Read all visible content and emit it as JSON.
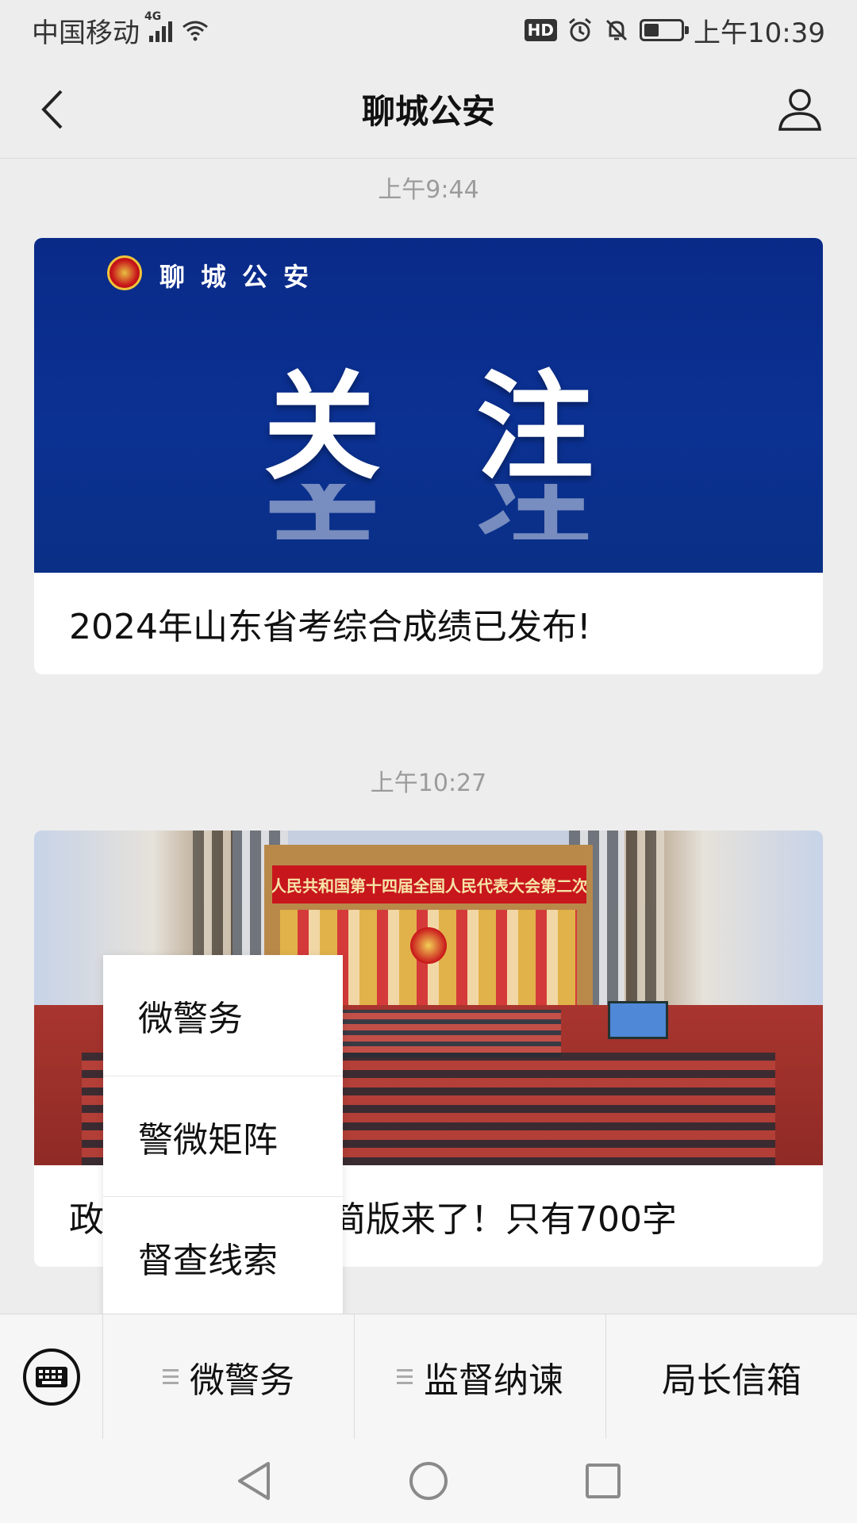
{
  "status_bar": {
    "carrier": "中国移动",
    "network_tag": "4G",
    "hd_label": "HD",
    "time": "上午10:39",
    "battery_level": 0.4
  },
  "nav": {
    "title": "聊城公安"
  },
  "messages": [
    {
      "time": "上午9:44",
      "image_brand": "聊城公安",
      "image_headline": "关注",
      "title": "2024年山东省考综合成绩已发布!"
    },
    {
      "time": "上午10:27",
      "image_banner": "中华人民共和国第十四届全国人民代表大会第二次会议",
      "title_prefix": "政",
      "title_suffix": "简版来了！只有700字"
    }
  ],
  "popup_menu": {
    "items": [
      "微警务",
      "警微矩阵",
      "督查线索"
    ]
  },
  "bottom_menu": {
    "items": [
      "微警务",
      "监督纳谏",
      "局长信箱"
    ]
  },
  "icons": {
    "back": "chevron-left-icon",
    "profile": "user-icon",
    "keyboard": "keyboard-icon",
    "nav_back": "triangle-back-icon",
    "nav_home": "circle-home-icon",
    "nav_recent": "square-recent-icon"
  }
}
